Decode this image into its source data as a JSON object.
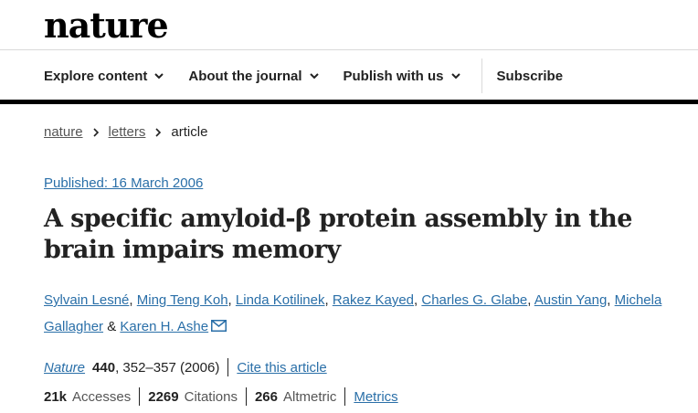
{
  "site": {
    "logo_text": "nature"
  },
  "nav": {
    "items": [
      {
        "label": "Explore content",
        "dropdown": true
      },
      {
        "label": "About the journal",
        "dropdown": true
      },
      {
        "label": "Publish with us",
        "dropdown": true
      }
    ],
    "subscribe": "Subscribe"
  },
  "breadcrumb": {
    "items": [
      "nature",
      "letters"
    ],
    "current": "article"
  },
  "article": {
    "published": "Published: 16 March 2006",
    "title": "A specific amyloid-β protein assembly in the brain impairs memory",
    "authors": [
      "Sylvain Lesné",
      "Ming Teng Koh",
      "Linda Kotilinek",
      "Rakez Kayed",
      "Charles G. Glabe",
      "Austin Yang",
      "Michela Gallagher",
      "Karen H. Ashe"
    ],
    "author_sep": ", ",
    "last_sep": " & ",
    "contact_icon": "mail-icon"
  },
  "citation": {
    "journal": "Nature",
    "volume": "440",
    "pages": ", 352–357 (2006)",
    "cite_link": "Cite this article"
  },
  "metrics": {
    "accesses_value": "21k",
    "accesses_label": "Accesses",
    "citations_value": "2269",
    "citations_label": "Citations",
    "altmetric_value": "266",
    "altmetric_label": "Altmetric",
    "link": "Metrics"
  },
  "colors": {
    "link": "#2a6fa8",
    "text": "#222222",
    "divider": "#dadada",
    "bar": "#000000"
  }
}
